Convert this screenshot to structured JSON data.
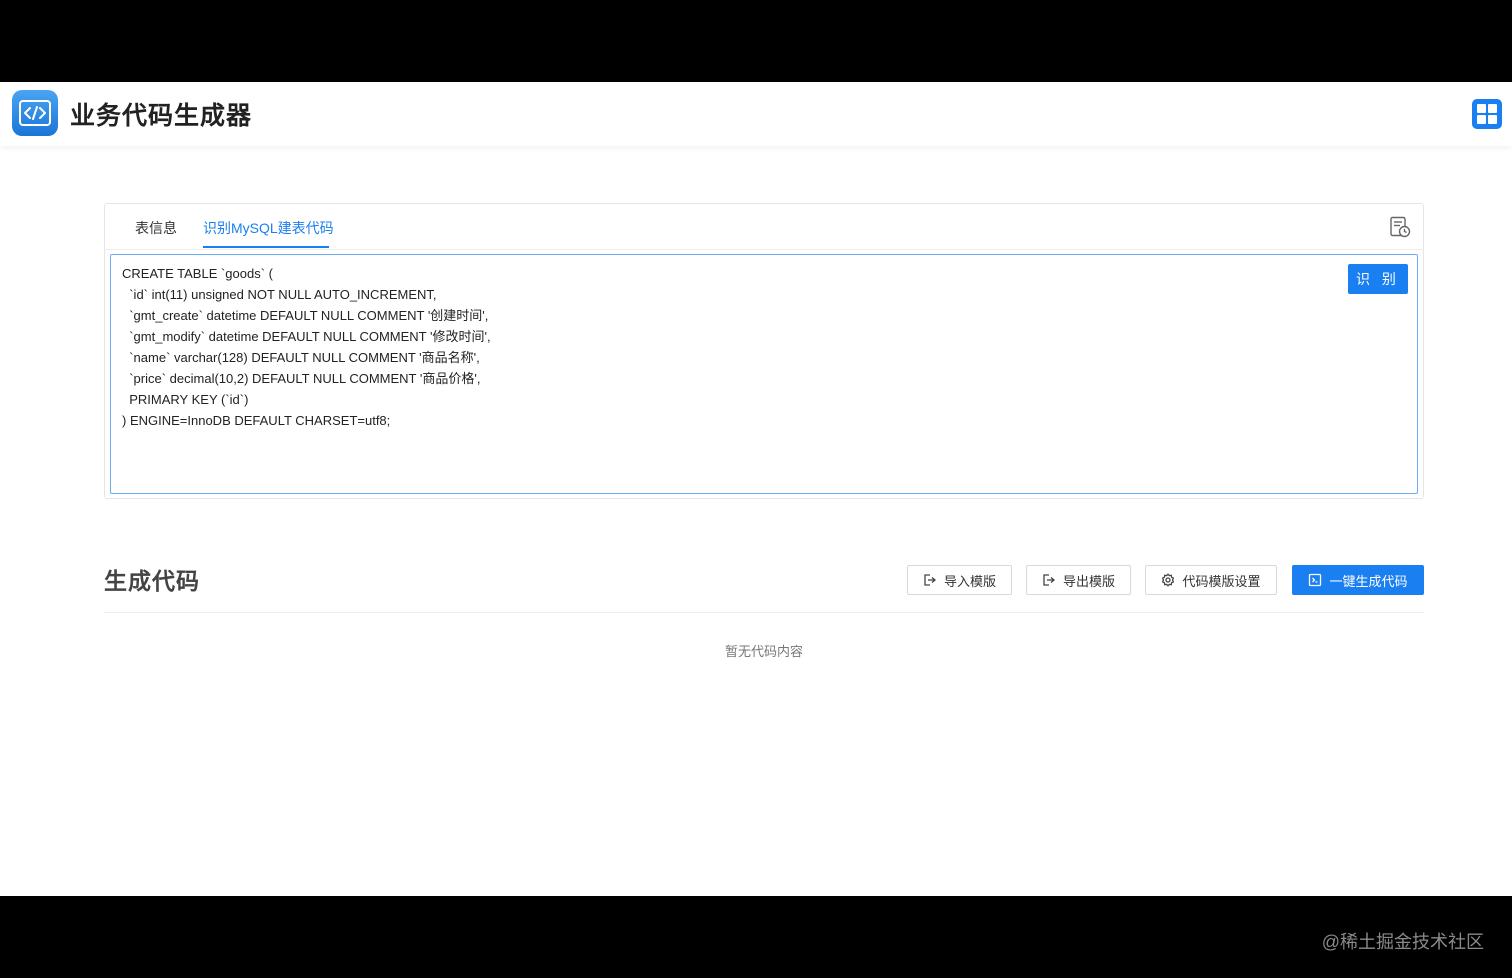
{
  "header": {
    "title": "业务代码生成器",
    "logo_icon": "code-window-icon",
    "menu_icon": "grid-icon"
  },
  "tabs": [
    {
      "label": "表信息",
      "active": false
    },
    {
      "label": "识别MySQL建表代码",
      "active": true
    }
  ],
  "editor": {
    "value": "CREATE TABLE `goods` (\n  `id` int(11) unsigned NOT NULL AUTO_INCREMENT,\n  `gmt_create` datetime DEFAULT NULL COMMENT '创建时间',\n  `gmt_modify` datetime DEFAULT NULL COMMENT '修改时间',\n  `name` varchar(128) DEFAULT NULL COMMENT '商品名称',\n  `price` decimal(10,2) DEFAULT NULL COMMENT '商品价格',\n  PRIMARY KEY (`id`)\n) ENGINE=InnoDB DEFAULT CHARSET=utf8;",
    "recognize_label": "识 别",
    "history_icon": "history-icon"
  },
  "generate": {
    "title": "生成代码",
    "import_label": "导入模版",
    "export_label": "导出模版",
    "settings_label": "代码模版设置",
    "generate_label": "一键生成代码",
    "empty_text": "暂无代码内容"
  },
  "watermark": "@稀土掘金技术社区",
  "colors": {
    "accent": "#1a7ff0",
    "background": "#ffffff"
  }
}
